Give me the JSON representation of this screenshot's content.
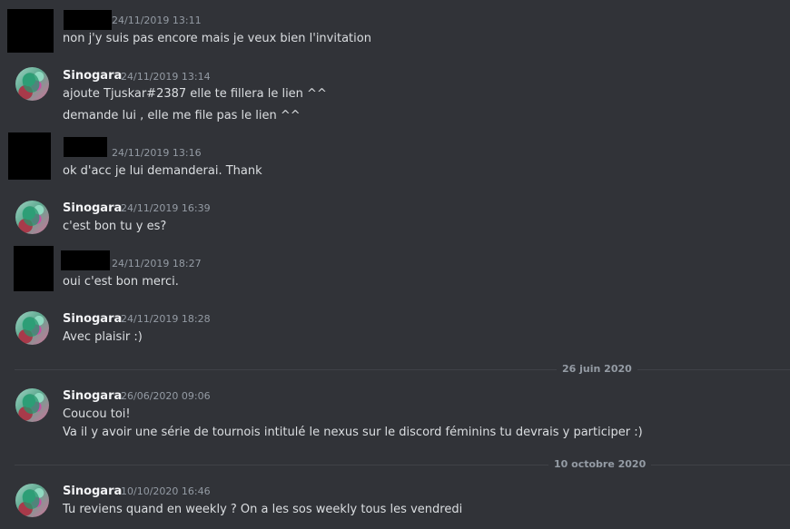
{
  "messages": [
    {
      "author": "",
      "redacted": true,
      "timestamp": "24/11/2019 13:11",
      "lines": [
        "non j'y suis pas encore mais je veux bien l'invitation"
      ]
    },
    {
      "author": "Sinogara",
      "redacted": false,
      "timestamp": "24/11/2019 13:14",
      "lines": [
        "ajoute Tjuskar#2387 elle te fillera le lien ^^",
        "demande lui , elle me file pas le lien ^^"
      ]
    },
    {
      "author": "",
      "redacted": true,
      "timestamp": "24/11/2019 13:16",
      "lines": [
        "ok d'acc je lui demanderai. Thank"
      ]
    },
    {
      "author": "Sinogara",
      "redacted": false,
      "timestamp": "24/11/2019 16:39",
      "lines": [
        "c'est bon tu y es?"
      ]
    },
    {
      "author": "",
      "redacted": true,
      "timestamp": "24/11/2019 18:27",
      "lines": [
        "oui c'est bon merci."
      ]
    },
    {
      "author": "Sinogara",
      "redacted": false,
      "timestamp": "24/11/2019 18:28",
      "lines": [
        "Avec plaisir :)"
      ]
    },
    {
      "author": "Sinogara",
      "redacted": false,
      "timestamp": "26/06/2020 09:06",
      "lines": [
        "Coucou toi!",
        "Va il y avoir une série de tournois intitulé le nexus sur le discord féminins tu devrais y participer :)"
      ]
    },
    {
      "author": "Sinogara",
      "redacted": false,
      "timestamp": "10/10/2020 16:46",
      "lines": [
        "Tu reviens quand en weekly ? On a les sos weekly tous les vendredi"
      ]
    }
  ],
  "dividers": [
    "26 juin 2020",
    "10 octobre 2020"
  ],
  "colors": {
    "background": "#313338",
    "text": "#dbdee1",
    "muted": "#949ba4",
    "author": "#f2f3f5"
  }
}
